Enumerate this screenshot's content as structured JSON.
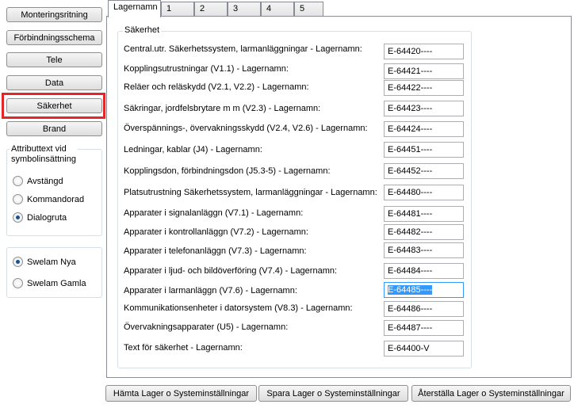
{
  "nav": {
    "monteringsritning": "Monteringsritning",
    "forbindningsschema": "Förbindningsschema",
    "tele": "Tele",
    "data": "Data",
    "sakerhet": "Säkerhet",
    "brand": "Brand"
  },
  "attribute_group": {
    "title_line1": "Attributtext vid",
    "title_line2": "symbolinsättning",
    "options": [
      "Avstängd",
      "Kommandorad",
      "Dialogruta"
    ],
    "selected": "Dialogruta"
  },
  "swelam_group": {
    "options": [
      "Swelam Nya",
      "Swelam Gamla"
    ],
    "selected": "Swelam Nya"
  },
  "tabs": [
    "Lagernamn",
    "1",
    "2",
    "3",
    "4",
    "5"
  ],
  "active_tab": "Lagernamn",
  "section": {
    "title": "Säkerhet",
    "rows": [
      {
        "label": "Central.utr. Säkerhetssystem, larmanläggningar - Lagernamn:",
        "value": "E-64420----"
      },
      {
        "label": "Kopplingsutrustningar (V1.1) - Lagernamn:",
        "value": "E-64421----"
      },
      {
        "label": "Reläer och reläskydd (V2.1, V2.2) - Lagernamn:",
        "value": "E-64422----"
      },
      {
        "label": "Säkringar, jordfelsbrytare m m (V2.3) - Lagernamn:",
        "value": "E-64423----"
      },
      {
        "label": "Överspännings-, övervakningsskydd (V2.4, V2.6) - Lagernamn:",
        "value": "E-64424----"
      },
      {
        "label": "Ledningar, kablar (J4) - Lagernamn:",
        "value": "E-64451----"
      },
      {
        "label": "Kopplingsdon, förbindningsdon (J5.3-5) - Lagernamn:",
        "value": "E-64452----"
      },
      {
        "label": "Platsutrustning Säkerhetssystem, larmanläggningar - Lagernamn:",
        "value": "E-64480----"
      },
      {
        "label": "Apparater i signalanläggn (V7.1) - Lagernamn:",
        "value": "E-64481----"
      },
      {
        "label": "Apparater i kontrollanläggn (V7.2) - Lagernamn:",
        "value": "E-64482----"
      },
      {
        "label": "Apparater i telefonanläggn (V7.3) - Lagernamn:",
        "value": "E-64483----"
      },
      {
        "label": "Apparater i ljud- och bildöverföring (V7.4) - Lagernamn:",
        "value": "E-64484----"
      },
      {
        "label": "Apparater i larmanläggn (V7.6) - Lagernamn:",
        "value": "E-64485----"
      },
      {
        "label": "Kommunikationsenheter i datorsystem (V8.3) - Lagernamn:",
        "value": "E-64486----"
      },
      {
        "label": "Övervakningsapparater (U5) - Lagernamn:",
        "value": "E-64487----"
      },
      {
        "label": "Text för säkerhet - Lagernamn:",
        "value": "E-64400-V"
      }
    ]
  },
  "footer": {
    "hamta": "Hämta Lager o Systeminställningar",
    "spara": "Spara Lager o Systeminställningar",
    "aterstalla": "Återställa Lager o Systeminställningar"
  },
  "colors": {
    "highlight": "#e2262a",
    "selection": "#3399ff",
    "border": "#898c95"
  }
}
